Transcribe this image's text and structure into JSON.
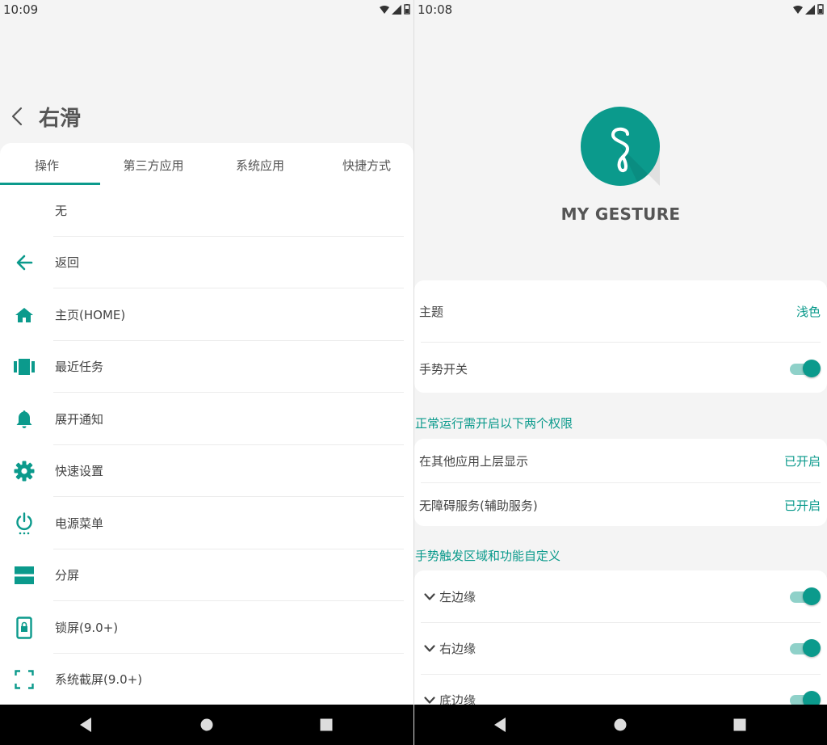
{
  "left": {
    "status_time": "10:09",
    "title": "右滑",
    "tabs": [
      "操作",
      "第三方应用",
      "系统应用",
      "快捷方式"
    ],
    "actions": [
      {
        "label": "无",
        "icon": "none"
      },
      {
        "label": "返回",
        "icon": "arrow-left-icon"
      },
      {
        "label": "主页(HOME)",
        "icon": "home-icon"
      },
      {
        "label": "最近任务",
        "icon": "recents-icon"
      },
      {
        "label": "展开通知",
        "icon": "bell-icon"
      },
      {
        "label": "快速设置",
        "icon": "gear-icon"
      },
      {
        "label": "电源菜单",
        "icon": "power-icon"
      },
      {
        "label": "分屏",
        "icon": "split-screen-icon"
      },
      {
        "label": "锁屏(9.0+)",
        "icon": "lock-phone-icon"
      },
      {
        "label": "系统截屏(9.0+)",
        "icon": "screenshot-icon"
      }
    ]
  },
  "right": {
    "status_time": "10:08",
    "app_name": "MY GESTURE",
    "settings": {
      "theme_label": "主题",
      "theme_value": "浅色",
      "gesture_switch_label": "手势开关",
      "gesture_switch_on": true
    },
    "permissions": {
      "section_title": "正常运行需开启以下两个权限",
      "overlay_label": "在其他应用上层显示",
      "overlay_value": "已开启",
      "accessibility_label": "无障碍服务(辅助服务)",
      "accessibility_value": "已开启"
    },
    "regions": {
      "section_title": "手势触发区域和功能自定义",
      "items": [
        {
          "label": "左边缘",
          "enabled": true
        },
        {
          "label": "右边缘",
          "enabled": true
        },
        {
          "label": "底边缘",
          "enabled": true
        }
      ]
    }
  },
  "colors": {
    "accent": "#0b9a8c",
    "accent_light": "#8fd1c9",
    "background": "#f4f4f4",
    "card": "#ffffff",
    "navbar": "#000000"
  }
}
